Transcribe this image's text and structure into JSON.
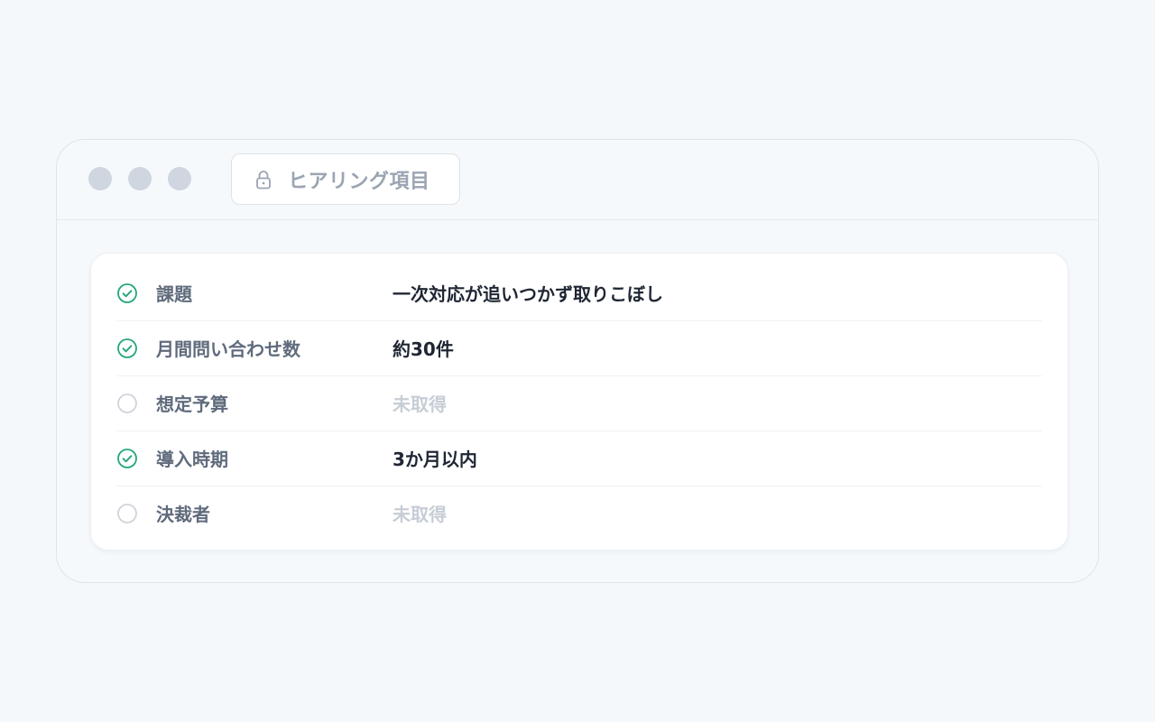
{
  "window": {
    "tab": {
      "icon": "lock-icon",
      "label": "ヒアリング項目"
    }
  },
  "colors": {
    "check": "#22a876",
    "pending": "#cfd4dc",
    "background": "#f5f8fb"
  },
  "checklist": {
    "items": [
      {
        "label": "課題",
        "value": "一次対応が追いつかず取りこぼし",
        "status": "done",
        "icon": "check-circle-icon"
      },
      {
        "label": "月間問い合わせ数",
        "value": "約30件",
        "status": "done",
        "icon": "check-circle-icon"
      },
      {
        "label": "想定予算",
        "value": "未取得",
        "status": "pending",
        "icon": "empty-circle-icon"
      },
      {
        "label": "導入時期",
        "value": "3か月以内",
        "status": "done",
        "icon": "check-circle-icon"
      },
      {
        "label": "決裁者",
        "value": "未取得",
        "status": "pending",
        "icon": "empty-circle-icon"
      }
    ]
  }
}
